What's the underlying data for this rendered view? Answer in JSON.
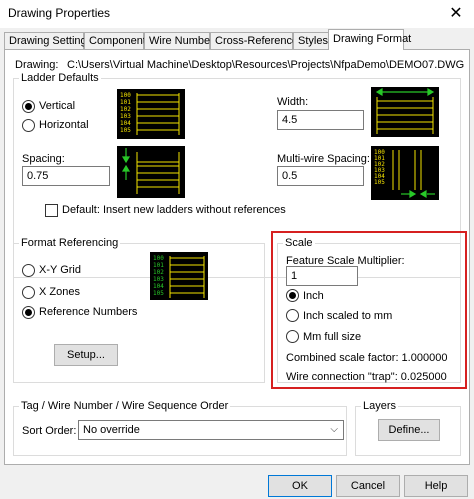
{
  "window": {
    "title": "Drawing Properties",
    "close_glyph": "✕"
  },
  "tabs": [
    {
      "label": "Drawing Settings"
    },
    {
      "label": "Components"
    },
    {
      "label": "Wire Numbers"
    },
    {
      "label": "Cross-References"
    },
    {
      "label": "Styles"
    },
    {
      "label": "Drawing Format",
      "active": true
    }
  ],
  "drawing": {
    "label": "Drawing:",
    "path": "C:\\Users\\Virtual Machine\\Desktop\\Resources\\Projects\\NfpaDemo\\DEMO07.DWG"
  },
  "ladder_defaults": {
    "title": "Ladder Defaults",
    "vertical_label": "Vertical",
    "horizontal_label": "Horizontal",
    "orientation_selected": "Vertical",
    "width_label": "Width:",
    "width_value": "4.5",
    "spacing_label": "Spacing:",
    "spacing_value": "0.75",
    "multiwire_label": "Multi-wire Spacing:",
    "multiwire_value": "0.5",
    "default_checkbox_label": "Default: Insert new ladders without references",
    "default_checked": false,
    "preview_rungs": [
      "100",
      "101",
      "102",
      "103",
      "104",
      "105"
    ]
  },
  "format_referencing": {
    "title": "Format Referencing",
    "xy_label": "X-Y Grid",
    "xzones_label": "X Zones",
    "refnum_label": "Reference Numbers",
    "selected": "Reference Numbers",
    "setup_label": "Setup...",
    "preview_rungs": [
      "100",
      "101",
      "102",
      "103",
      "104",
      "105"
    ]
  },
  "scale": {
    "title": "Scale",
    "feature_label": "Feature Scale Multiplier:",
    "feature_value": "1",
    "inch_label": "Inch",
    "inch_mm_label": "Inch scaled to mm",
    "mm_label": "Mm full size",
    "selected": "Inch",
    "combined_label": "Combined scale factor: 1.000000",
    "trap_label": "Wire connection \"trap\": 0.025000"
  },
  "tag_order": {
    "title": "Tag / Wire Number / Wire Sequence Order",
    "sort_label": "Sort Order:",
    "sort_value": "No override"
  },
  "layers": {
    "title": "Layers",
    "define_label": "Define..."
  },
  "buttons": {
    "ok": "OK",
    "cancel": "Cancel",
    "help": "Help"
  },
  "colors": {
    "highlight": "#d62020",
    "preview_line": "#f5e400",
    "preview_arrow": "#28c828"
  }
}
